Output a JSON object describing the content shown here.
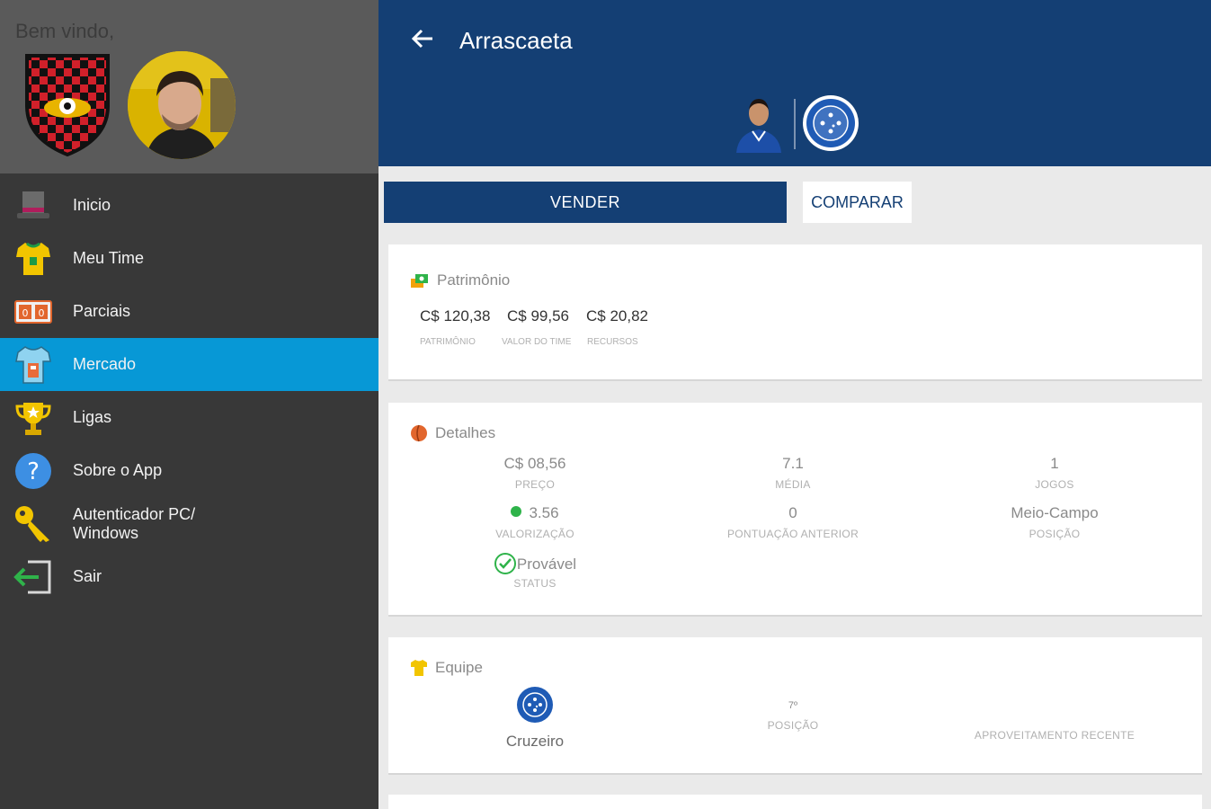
{
  "sidebar": {
    "welcome": "Bem vindo,",
    "items": [
      {
        "label": "Inicio",
        "icon": "hat-icon"
      },
      {
        "label": "Meu Time",
        "icon": "jersey-icon"
      },
      {
        "label": "Parciais",
        "icon": "scoreboard-icon"
      },
      {
        "label": "Mercado",
        "icon": "market-jersey-icon"
      },
      {
        "label": "Ligas",
        "icon": "trophy-icon"
      },
      {
        "label": "Sobre o App",
        "icon": "question-icon"
      },
      {
        "label": "Autenticador PC/ Windows",
        "icon": "key-icon"
      },
      {
        "label": "Sair",
        "icon": "exit-icon"
      }
    ],
    "active_item": "Mercado"
  },
  "header": {
    "title": "Arrascaeta"
  },
  "actions": {
    "sell": "VENDER",
    "compare": "COMPARAR"
  },
  "patrimonio": {
    "title": "Patrimônio",
    "values": [
      {
        "value": "C$ 120,38",
        "label": "PATRIMÔNIO"
      },
      {
        "value": "C$ 99,56",
        "label": "VALOR DO TIME"
      },
      {
        "value": "C$ 20,82",
        "label": "RECURSOS"
      }
    ]
  },
  "detalhes": {
    "title": "Detalhes",
    "price": {
      "value": "C$ 08,56",
      "label": "PREÇO"
    },
    "media": {
      "value": "7.1",
      "label": "MÉDIA"
    },
    "jogos": {
      "value": "1",
      "label": "JOGOS"
    },
    "valorizacao": {
      "value": "3.56",
      "label": "VALORIZAÇÃO"
    },
    "pontuacao": {
      "value": "0",
      "label": "PONTUAÇÃO ANTERIOR"
    },
    "posicao": {
      "value": "Meio-Campo",
      "label": "POSIÇÃO"
    },
    "status": {
      "value": "Provável",
      "label": "STATUS"
    }
  },
  "equipe": {
    "title": "Equipe",
    "club": "Cruzeiro",
    "rank": "7º",
    "rank_label": "POSIÇÃO",
    "recent_label": "APROVEITAMENTO RECENTE"
  },
  "colors": {
    "primary": "#143f74",
    "accent": "#0798d6",
    "sidebar_bg": "#383838",
    "positive": "#2fb34a"
  }
}
